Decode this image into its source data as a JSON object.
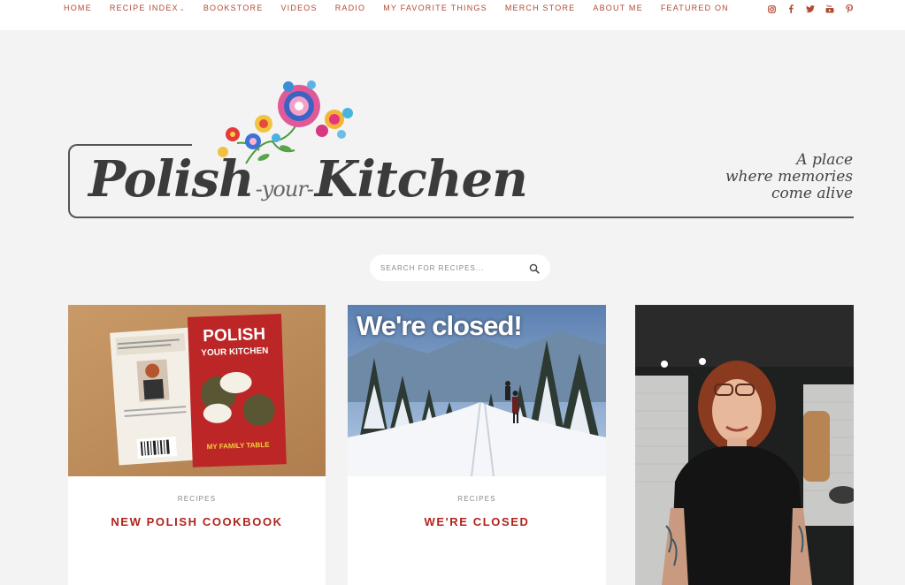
{
  "nav": {
    "items": [
      {
        "label": "HOME"
      },
      {
        "label": "RECIPE INDEX",
        "caret": "⌄"
      },
      {
        "label": "BOOKSTORE"
      },
      {
        "label": "VIDEOS"
      },
      {
        "label": "RADIO"
      },
      {
        "label": "MY FAVORITE THINGS"
      },
      {
        "label": "MERCH STORE"
      },
      {
        "label": "ABOUT ME"
      },
      {
        "label": "FEATURED ON"
      }
    ],
    "social": [
      "instagram-icon",
      "facebook-icon",
      "twitter-icon",
      "youtube-icon",
      "pinterest-icon"
    ]
  },
  "logo": {
    "word1": "Polish",
    "word2": "-your-",
    "word3": "Kitchen"
  },
  "tagline": {
    "line1": "A place",
    "line2": "where memories",
    "line3": "come alive"
  },
  "search": {
    "placeholder": "SEARCH FOR RECIPES..."
  },
  "cards": [
    {
      "category": "RECIPES",
      "title": "NEW POLISH COOKBOOK",
      "book_title": "POLISH",
      "book_subtitle": "YOUR KITCHEN",
      "book_footer": "MY FAMILY TABLE"
    },
    {
      "category": "RECIPES",
      "title": "WE'RE CLOSED",
      "overlay": "We're closed!"
    },
    {}
  ],
  "colors": {
    "accent": "#b0241b",
    "nav": "#b24a33",
    "background": "#f3f3f3"
  }
}
